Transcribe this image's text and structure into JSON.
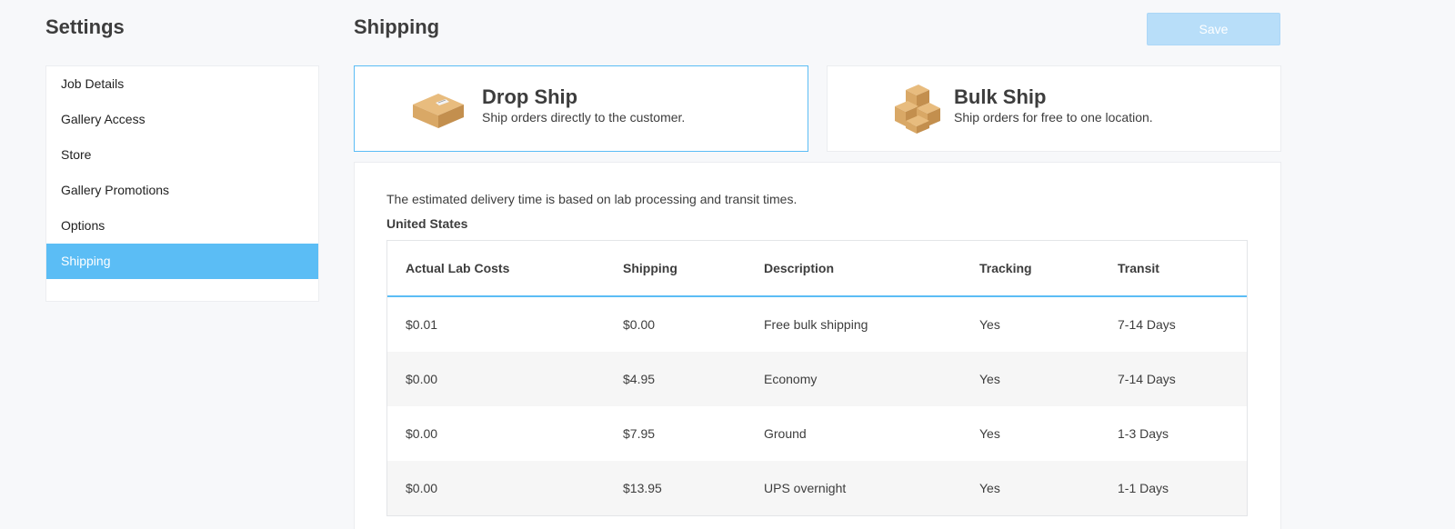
{
  "settings": {
    "title": "Settings"
  },
  "sidebar": {
    "items": [
      {
        "label": "Job Details"
      },
      {
        "label": "Gallery Access"
      },
      {
        "label": "Store"
      },
      {
        "label": "Gallery Promotions"
      },
      {
        "label": "Options"
      },
      {
        "label": "Shipping",
        "active": true
      }
    ]
  },
  "header": {
    "title": "Shipping",
    "save_label": "Save"
  },
  "shipping_options": [
    {
      "title": "Drop Ship",
      "description": "Ship orders directly to the customer.",
      "icon": "box-icon",
      "selected": true
    },
    {
      "title": "Bulk Ship",
      "description": "Ship orders for free to one location.",
      "icon": "stacked-boxes-icon",
      "selected": false
    }
  ],
  "panel": {
    "note": "The estimated delivery time is based on lab processing and transit times.",
    "region": "United States",
    "table": {
      "headers": [
        "Actual Lab Costs",
        "Shipping",
        "Description",
        "Tracking",
        "Transit"
      ],
      "rows": [
        [
          "$0.01",
          "$0.00",
          "Free bulk shipping",
          "Yes",
          "7-14 Days"
        ],
        [
          "$0.00",
          "$4.95",
          "Economy",
          "Yes",
          "7-14 Days"
        ],
        [
          "$0.00",
          "$7.95",
          "Ground",
          "Yes",
          "1-3 Days"
        ],
        [
          "$0.00",
          "$13.95",
          "UPS overnight",
          "Yes",
          "1-1 Days"
        ]
      ]
    }
  },
  "colors": {
    "accent": "#5bbdf5",
    "save_disabled": "#b8def9",
    "box": "#d9a866"
  }
}
